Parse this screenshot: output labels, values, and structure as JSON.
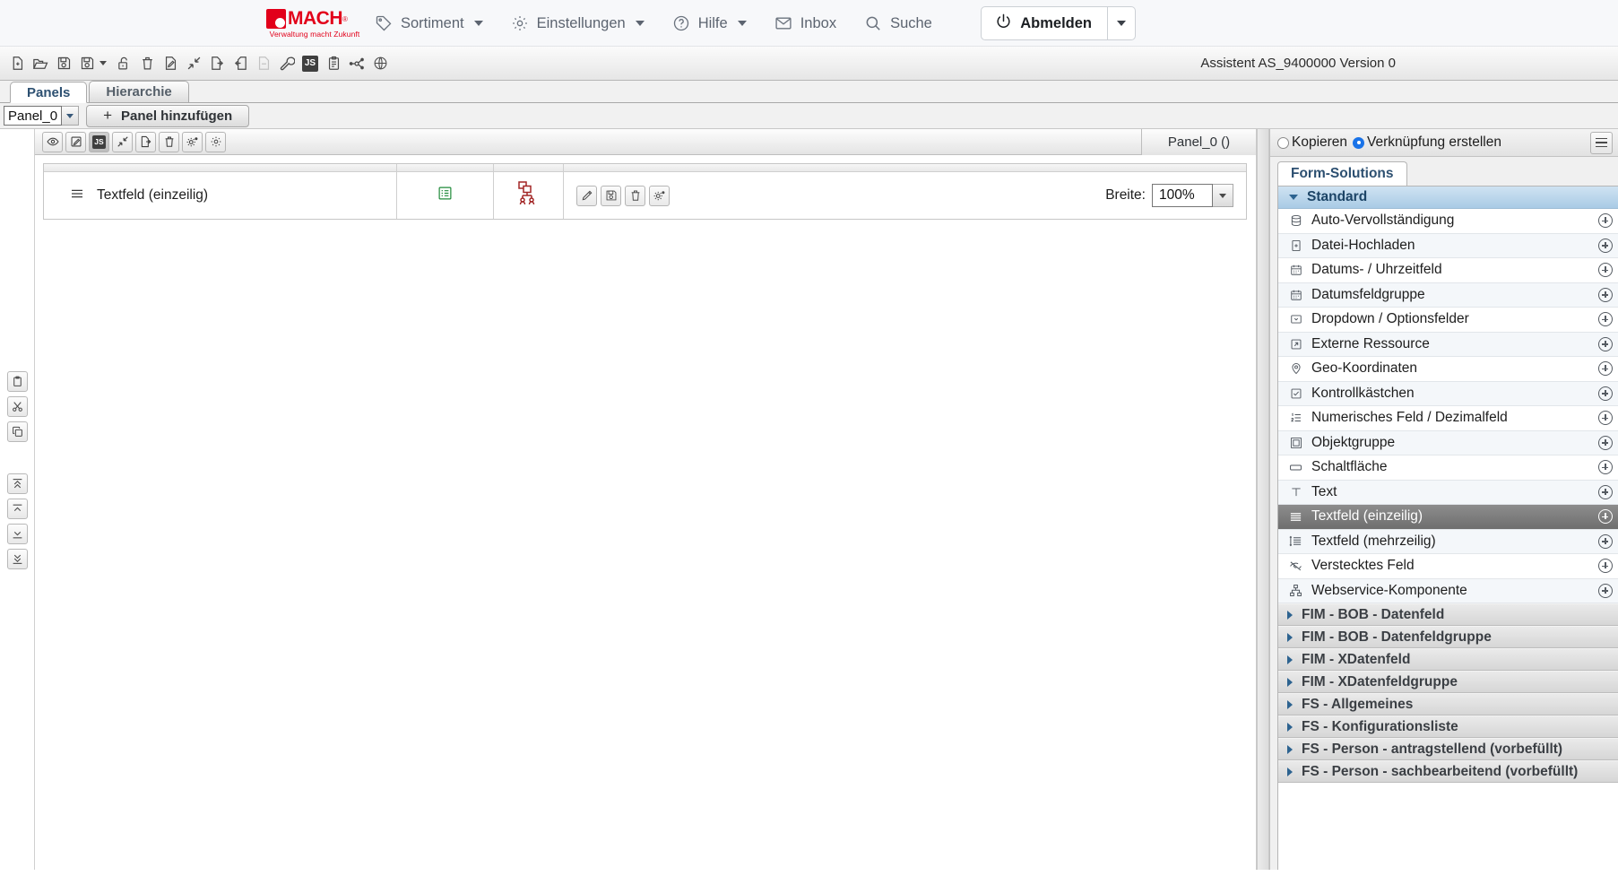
{
  "header": {
    "brand": {
      "name": "MACH",
      "registered": "®",
      "tagline": "Verwaltung macht Zukunft"
    },
    "nav": [
      {
        "label": "Sortiment",
        "icon": "tag-icon",
        "caret": true
      },
      {
        "label": "Einstellungen",
        "icon": "gear-icon",
        "caret": true
      },
      {
        "label": "Hilfe",
        "icon": "question-circle-icon",
        "caret": true
      },
      {
        "label": "Inbox",
        "icon": "envelope-icon",
        "caret": false
      },
      {
        "label": "Suche",
        "icon": "search-icon",
        "caret": false
      }
    ],
    "logout": {
      "label": "Abmelden",
      "icon": "power-icon"
    }
  },
  "toolbar": {
    "status": "Assistent AS_9400000 Version 0",
    "icons": [
      {
        "name": "new-document-icon",
        "disabled": false
      },
      {
        "name": "open-folder-icon",
        "disabled": false
      },
      {
        "name": "save-icon",
        "disabled": false
      },
      {
        "name": "save-as-icon",
        "disabled": false,
        "caret": true
      },
      {
        "name": "unlock-icon",
        "disabled": false
      },
      {
        "name": "delete-trash-icon",
        "disabled": false
      },
      {
        "name": "rename-edit-icon",
        "disabled": false
      },
      {
        "name": "collapse-arrows-icon",
        "disabled": false
      },
      {
        "name": "export-icon",
        "disabled": false
      },
      {
        "name": "import-icon",
        "disabled": false
      },
      {
        "name": "document-disabled-icon",
        "disabled": true
      },
      {
        "name": "wrench-icon",
        "disabled": false
      },
      {
        "name": "javascript-icon",
        "disabled": false,
        "badge": "JS"
      },
      {
        "name": "clipboard-icon",
        "disabled": false
      },
      {
        "name": "node-graph-icon",
        "disabled": false
      },
      {
        "name": "globe-icon",
        "disabled": false
      }
    ]
  },
  "tabs": [
    {
      "label": "Panels",
      "active": true
    },
    {
      "label": "Hierarchie",
      "active": false
    }
  ],
  "panel_selector": {
    "value": "Panel_0",
    "add_button_label": "Panel hinzufügen",
    "add_button_plus": "+"
  },
  "editor": {
    "title": "Panel_0 ()",
    "toolbar_icons": [
      {
        "name": "preview-eye-icon",
        "pressed": false
      },
      {
        "name": "edit-pencil-icon",
        "pressed": false
      },
      {
        "name": "javascript-icon",
        "pressed": true,
        "badge": "JS"
      },
      {
        "name": "validation-icon",
        "pressed": false
      },
      {
        "name": "export-panel-icon",
        "pressed": false
      },
      {
        "name": "delete-panel-icon",
        "pressed": false
      },
      {
        "name": "panel-settings-icon",
        "pressed": false
      },
      {
        "name": "gear-icon",
        "pressed": false
      }
    ],
    "row": {
      "label": "Textfeld (einzeilig)",
      "drag_handle_icon": "drag-handle-icon",
      "list-icon": "green-table-icon",
      "link-icon": "red-link-group-icon",
      "actions": [
        {
          "name": "edit-pencil-icon"
        },
        {
          "name": "copy-save-icon"
        },
        {
          "name": "delete-trash-icon"
        },
        {
          "name": "settings-cog-icon"
        }
      ],
      "breite_label": "Breite:",
      "breite_value": "100%"
    }
  },
  "left_gutter": {
    "buttons": [
      {
        "name": "paste-icon"
      },
      {
        "name": "cut-icon"
      },
      {
        "name": "copy-icon"
      },
      {
        "name": "move-top-icon"
      },
      {
        "name": "move-up-icon"
      },
      {
        "name": "move-down-icon"
      },
      {
        "name": "move-bottom-icon"
      }
    ]
  },
  "sidebar": {
    "mode_options": [
      {
        "label": "Kopieren",
        "selected": false
      },
      {
        "label": "Verknüpfung erstellen",
        "selected": true
      }
    ],
    "menu_icon": "hamburger-menu-icon",
    "tab_label": "Form-Solutions",
    "groups": [
      {
        "label": "Standard",
        "expanded": true,
        "items": [
          {
            "label": "Auto-Vervollständigung",
            "icon": "database-icon"
          },
          {
            "label": "Datei-Hochladen",
            "icon": "file-upload-icon"
          },
          {
            "label": "Datums- / Uhrzeitfeld",
            "icon": "calendar-icon"
          },
          {
            "label": "Datumsfeldgruppe",
            "icon": "calendar-icon"
          },
          {
            "label": "Dropdown / Optionsfelder",
            "icon": "dropdown-icon"
          },
          {
            "label": "Externe Ressource",
            "icon": "external-link-icon"
          },
          {
            "label": "Geo-Koordinaten",
            "icon": "map-pin-icon"
          },
          {
            "label": "Kontrollkästchen",
            "icon": "checkbox-icon"
          },
          {
            "label": "Numerisches Feld / Dezimalfeld",
            "icon": "numeric-list-icon"
          },
          {
            "label": "Objektgruppe",
            "icon": "object-group-icon"
          },
          {
            "label": "Schaltfläche",
            "icon": "button-icon"
          },
          {
            "label": "Text",
            "icon": "text-t-icon"
          },
          {
            "label": "Textfeld (einzeilig)",
            "icon": "single-line-text-icon",
            "selected": true
          },
          {
            "label": "Textfeld (mehrzeilig)",
            "icon": "multi-line-text-icon"
          },
          {
            "label": "Verstecktes Feld",
            "icon": "eye-off-icon"
          },
          {
            "label": "Webservice-Komponente",
            "icon": "sitemap-icon"
          }
        ]
      },
      {
        "label": "FIM - BOB - Datenfeld",
        "expanded": false,
        "items": []
      },
      {
        "label": "FIM - BOB - Datenfeldgruppe",
        "expanded": false,
        "items": []
      },
      {
        "label": "FIM - XDatenfeld",
        "expanded": false,
        "items": []
      },
      {
        "label": "FIM - XDatenfeldgruppe",
        "expanded": false,
        "items": []
      },
      {
        "label": "FS - Allgemeines",
        "expanded": false,
        "items": []
      },
      {
        "label": "FS - Konfigurationsliste",
        "expanded": false,
        "items": []
      },
      {
        "label": "FS - Person - antragstellend (vorbefüllt)",
        "expanded": false,
        "items": []
      },
      {
        "label": "FS - Person - sachbearbeitend (vorbefüllt)",
        "expanded": false,
        "items": []
      }
    ]
  },
  "colors": {
    "brand_red": "#e2001a",
    "accent_blue": "#1a73e8",
    "group_header_blue": "#a9cbe5",
    "selected_gray": "#7a7a7a"
  }
}
